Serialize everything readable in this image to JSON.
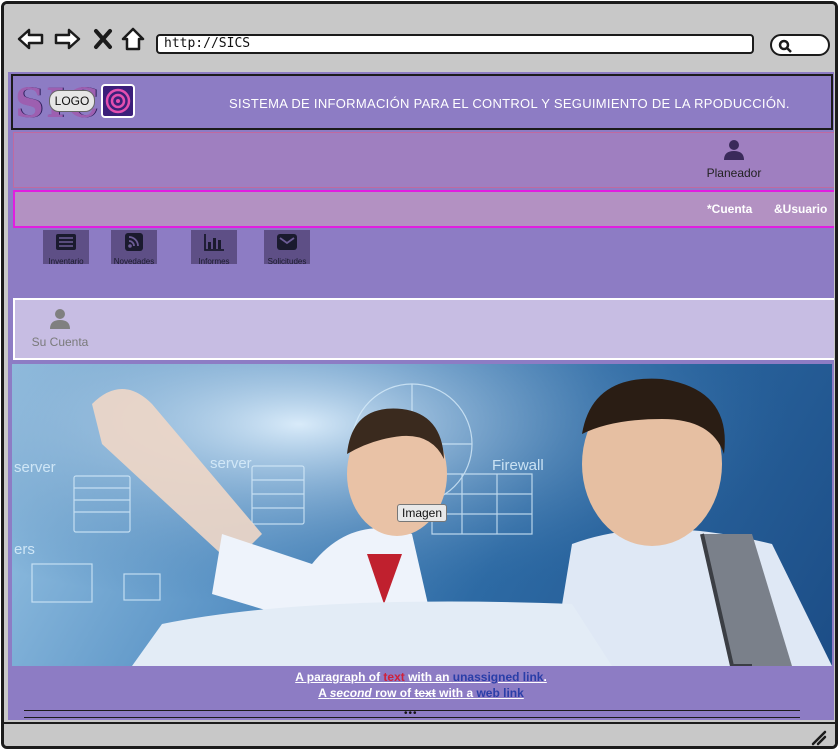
{
  "browser": {
    "url": "http://SICS",
    "icons": [
      "back-arrow-icon",
      "forward-arrow-icon",
      "close-x-icon",
      "home-icon",
      "search-icon"
    ]
  },
  "header": {
    "logo_letters": "SICS",
    "logo_text": "LOGO",
    "title": "SISTEMA DE INFORMACIÓN PARA EL CONTROL Y SEGUIMIENTO DE LA RPODUCCIÓN."
  },
  "user": {
    "role": "Planeador"
  },
  "menu": {
    "account": "*Cuenta",
    "user": "&Usuario"
  },
  "tiles": [
    {
      "label": "Inventario",
      "icon": "list-icon"
    },
    {
      "label": "Novedades",
      "icon": "rss-icon"
    },
    {
      "label": "Informes",
      "icon": "bar-chart-icon"
    },
    {
      "label": "Solicitudes",
      "icon": "envelope-icon"
    }
  ],
  "account_panel": {
    "label": "Su Cuenta"
  },
  "hero": {
    "label": "Imagen",
    "server_text_1": "server",
    "server_text_2": "server",
    "firewall_text": "Firewall",
    "users_text": "ers"
  },
  "footer_text": {
    "p1_a": "A paragraph of ",
    "p1_red": "text",
    "p1_b": " with an ",
    "p1_link": "unassigned link",
    "p1_c": ".",
    "p2_a": "A ",
    "p2_em": "second",
    "p2_b": " row of ",
    "p2_strike": "text",
    "p2_c": " with a ",
    "p2_link": "web link",
    "pager": "•••"
  },
  "colors": {
    "page_bg": "#8d7cc4",
    "menu_border": "#e11ee0",
    "link_red": "#d0213a",
    "link_blue": "#2a3ea8"
  }
}
